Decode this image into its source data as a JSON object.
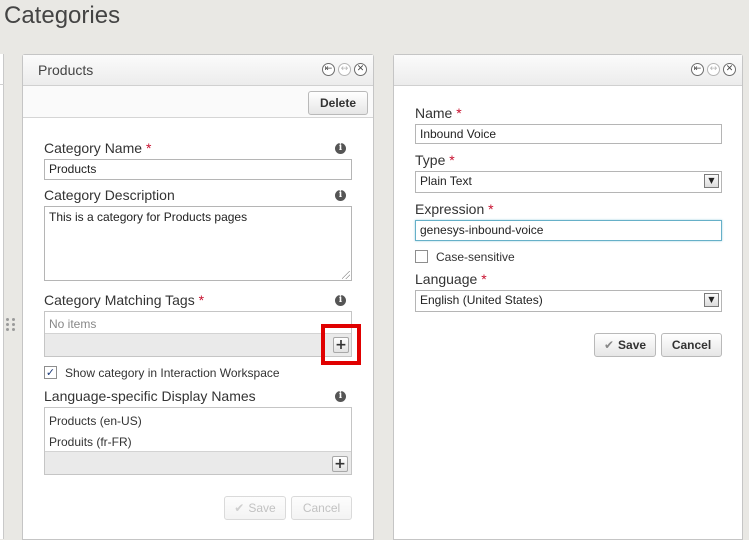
{
  "page": {
    "title": "Categories"
  },
  "left_panel": {
    "title": "Products",
    "delete_label": "Delete",
    "category_name": {
      "label": "Category Name",
      "required": "*",
      "value": "Products"
    },
    "category_description": {
      "label": "Category Description",
      "value": "This is a category for Products pages"
    },
    "matching_tags": {
      "label": "Category Matching Tags",
      "required": "*",
      "empty_text": "No items"
    },
    "show_in_workspace": {
      "label": "Show category in Interaction Workspace",
      "checked": true
    },
    "display_names": {
      "label": "Language-specific Display Names",
      "items": [
        {
          "label": "Products (en-US)"
        },
        {
          "label": "Produits (fr-FR)"
        }
      ]
    },
    "save_label": "Save",
    "cancel_label": "Cancel"
  },
  "right_panel": {
    "name": {
      "label": "Name",
      "required": "*",
      "value": "Inbound Voice"
    },
    "type": {
      "label": "Type",
      "required": "*",
      "value": "Plain Text"
    },
    "expression": {
      "label": "Expression",
      "required": "*",
      "value": "genesys-inbound-voice"
    },
    "case_sensitive": {
      "label": "Case-sensitive",
      "checked": false
    },
    "language": {
      "label": "Language",
      "required": "*",
      "value": "English (United States)"
    },
    "save_label": "Save",
    "cancel_label": "Cancel"
  },
  "colors": {
    "highlight": "#e00000",
    "required": "#c8102e",
    "focus_border": "#66b0c8"
  }
}
